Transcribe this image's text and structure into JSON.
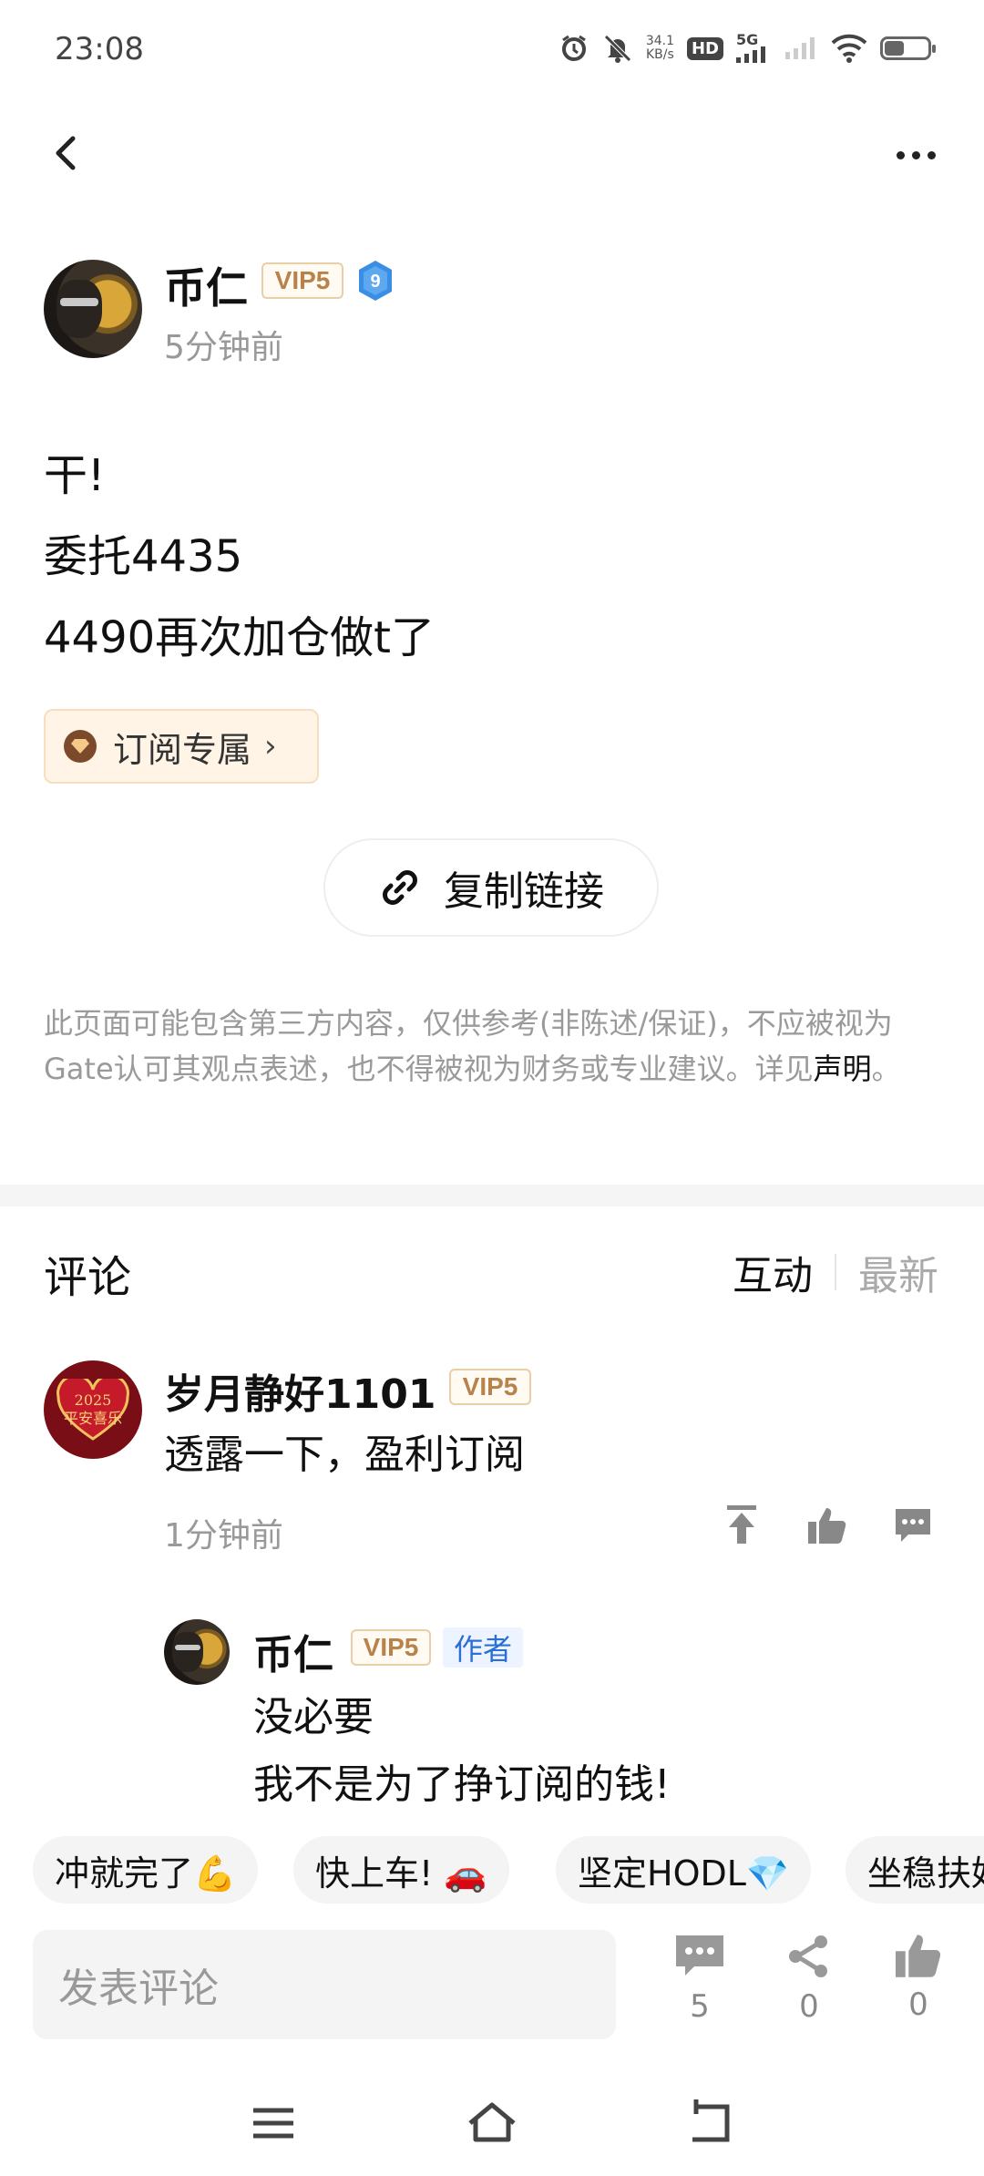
{
  "status_bar": {
    "time": "23:08",
    "net_speed_value": "34.1",
    "net_speed_unit": "KB/s",
    "hd_label": "HD",
    "net_type": "5G",
    "battery_level": 0.45
  },
  "author": {
    "name": "币仁",
    "vip": "VIP5",
    "level": "9",
    "time": "5分钟前"
  },
  "post": {
    "lines": [
      "干!",
      "委托4435",
      "4490再次加仓做t了"
    ],
    "subscription_chip": "订阅专属",
    "copy_link": "复制链接",
    "disclaimer": "此页面可能包含第三方内容，仅供参考(非陈述/保证)，不应被视为Gate认可其观点表述，也不得被视为财务或专业建议。详见",
    "disclaimer_link": "声明",
    "disclaimer_end": "。"
  },
  "comments": {
    "title": "评论",
    "sort_tabs": [
      {
        "label": "互动",
        "active": true
      },
      {
        "label": "最新",
        "active": false
      }
    ],
    "items": [
      {
        "name": "岁月静好1101",
        "vip": "VIP5",
        "avatar_text": "2025\n平安喜乐",
        "text": "透露一下，盈利订阅",
        "time": "1分钟前",
        "reply": {
          "name": "币仁",
          "vip": "VIP5",
          "tag": "作者",
          "lines": [
            "没必要",
            "我不是为了挣订阅的钱!"
          ]
        }
      }
    ]
  },
  "quick_replies": [
    "冲就完了💪",
    "快上车! 🚗",
    "坚定HODL💎",
    "坐稳扶好"
  ],
  "bottom_bar": {
    "input_placeholder": "发表评论",
    "comment_count": "5",
    "share_count": "0",
    "like_count": "0"
  },
  "colors": {
    "vip_text": "#b8824a",
    "author_tag": "#2a6fd6",
    "level_badge": "#3a8ee6",
    "muted": "#999999"
  }
}
